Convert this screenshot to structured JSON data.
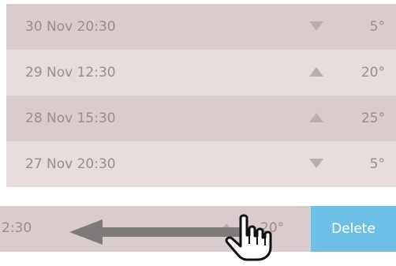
{
  "rows": [
    {
      "date": "30 Nov 20:30",
      "trend": "down",
      "temp": "5°"
    },
    {
      "date": "29 Nov 12:30",
      "trend": "up",
      "temp": "20°"
    },
    {
      "date": "28 Nov 15:30",
      "trend": "up",
      "temp": "25°"
    },
    {
      "date": "27 Nov 20:30",
      "trend": "down",
      "temp": "5°"
    }
  ],
  "swiped_row": {
    "date_partial": "2:30",
    "trend": "up",
    "temp": "20°",
    "delete_label": "Delete"
  },
  "colors": {
    "row_dark": "#d8cccc",
    "row_light": "#e7dcdc",
    "text": "#9a8e8f",
    "trend_icon": "#b9aeae",
    "delete_bg": "#6dbfe6",
    "gesture_arrow": "#7f7a7a"
  },
  "icons": {
    "trend_down": "triangle-down-icon",
    "trend_up": "triangle-up-icon",
    "gesture_arrow": "arrow-left-icon",
    "cursor": "hand-pointer-icon"
  }
}
